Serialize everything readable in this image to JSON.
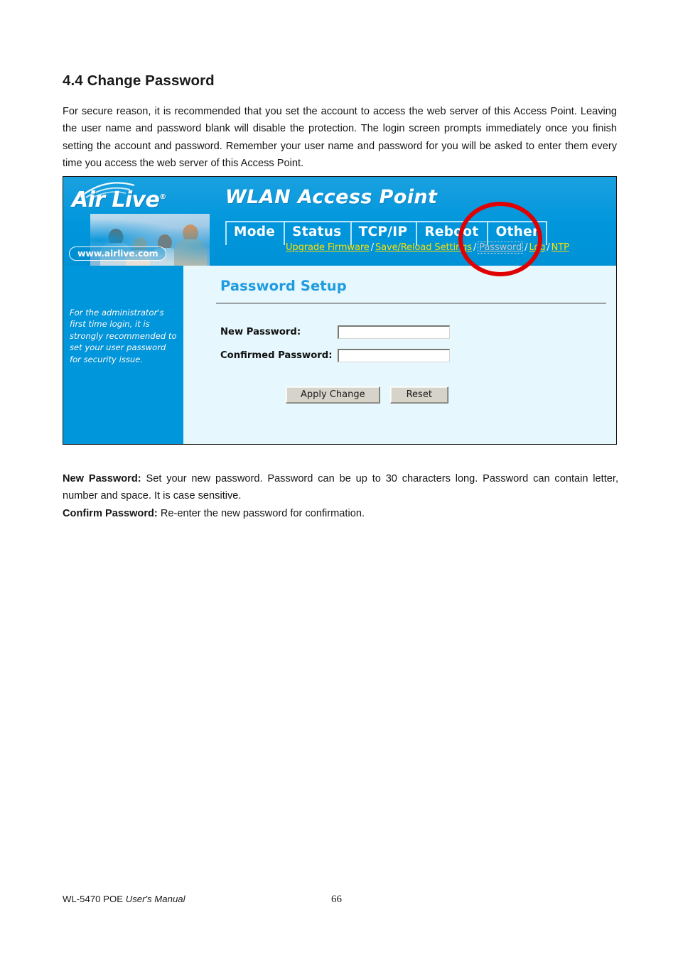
{
  "document": {
    "heading": "4.4 Change Password",
    "intro_paragraph": "For secure reason, it is recommended that you set the account to access the web server of this Access Point. Leaving the user name and password blank will disable the protection. The login screen prompts immediately once you finish setting the account and password.   Remember your user name and password for you will be asked to enter them every time you access the web server of this Access Point.",
    "field_notes": [
      {
        "lead": "New Password:",
        "text": " Set your new password. Password can be up to 30 characters long. Password can contain letter, number and space. It is case sensitive."
      },
      {
        "lead": "Confirm Password:",
        "text": " Re-enter the new password for confirmation."
      }
    ],
    "footer": {
      "model": "WL-5470 POE ",
      "manual": "User's Manual",
      "page_number": "66"
    }
  },
  "screenshot": {
    "brand": {
      "logo_text": "Air Live",
      "registered_mark": "®",
      "url_badge": "www.airlive.com"
    },
    "title": "WLAN Access Point",
    "nav_tabs": [
      {
        "label": "Mode"
      },
      {
        "label": "Status"
      },
      {
        "label": "TCP/IP"
      },
      {
        "label": "Reboot"
      },
      {
        "label": "Other"
      }
    ],
    "sub_nav": {
      "separator": "/",
      "items": [
        {
          "label": "Upgrade Firmware",
          "state": "link"
        },
        {
          "label": "Save/Reload Settings",
          "state": "link"
        },
        {
          "label": "Password",
          "state": "current"
        },
        {
          "label": "Log",
          "state": "link"
        },
        {
          "label": "NTP",
          "state": "link"
        }
      ]
    },
    "sidebar": {
      "note": "For the administrator's first time login, it is strongly recommended to set your user password for security issue."
    },
    "content": {
      "heading": "Password Setup",
      "fields": [
        {
          "label": "New Password:",
          "value": "",
          "placeholder": ""
        },
        {
          "label": "Confirmed Password:",
          "value": "",
          "placeholder": ""
        }
      ],
      "buttons": {
        "apply": "Apply Change",
        "reset": "Reset"
      }
    },
    "annotation": {
      "type": "red-circle-highlight",
      "target": "Password"
    },
    "colors": {
      "header_blue": "#0096dc",
      "content_bg": "#e6f7fd",
      "link_yellow": "#ffe400",
      "heading_blue": "#1f9ce0",
      "annotation_red": "#e00000"
    }
  }
}
